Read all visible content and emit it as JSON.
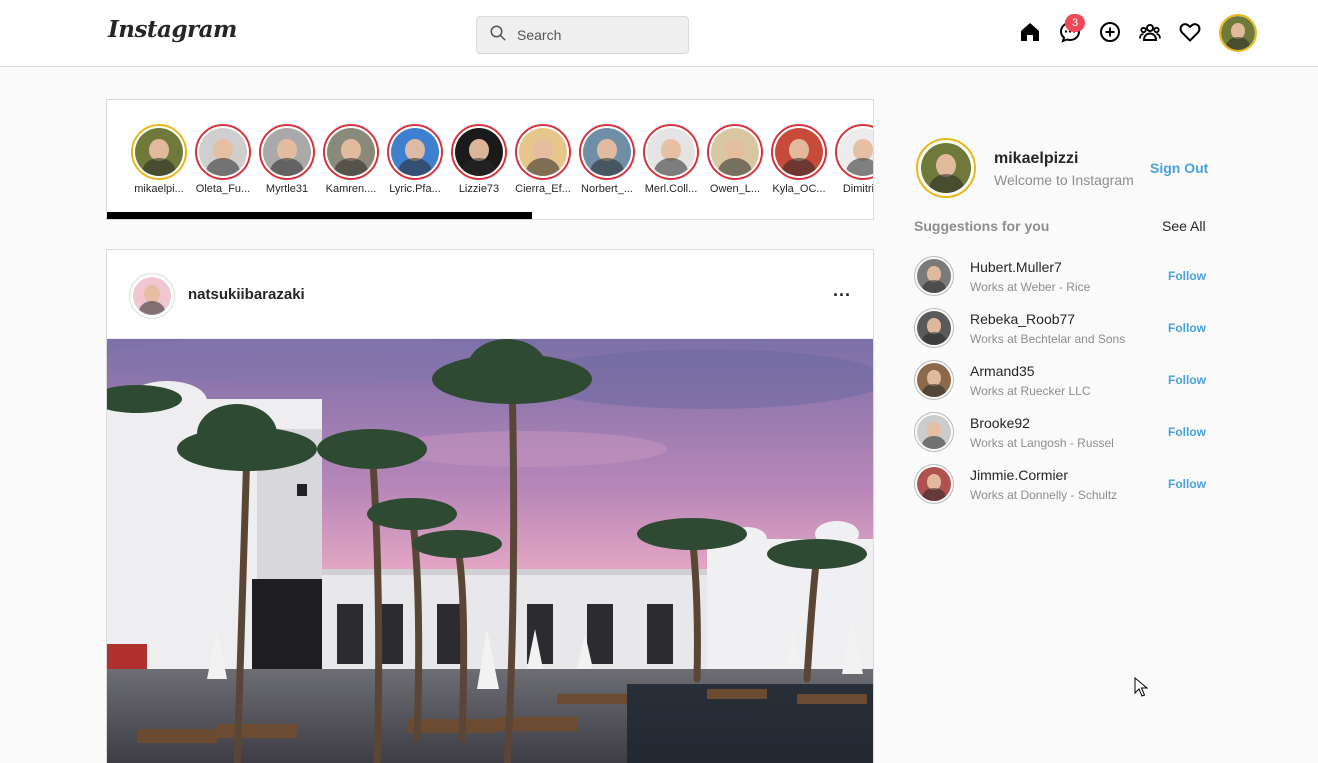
{
  "header": {
    "logo": "Instagram",
    "search_placeholder": "Search",
    "messages_badge": "3"
  },
  "stories": [
    {
      "name": "mikaelpi...",
      "own": true,
      "color": "#6f7a3a"
    },
    {
      "name": "Oleta_Fu...",
      "color": "#cfcfcf"
    },
    {
      "name": "Myrtle31",
      "color": "#a9a9a9"
    },
    {
      "name": "Kamren....",
      "color": "#8a8a7a"
    },
    {
      "name": "Lyric.Pfa...",
      "color": "#3f7fd0"
    },
    {
      "name": "Lizzie73",
      "color": "#1a1a1a"
    },
    {
      "name": "Cierra_Ef...",
      "color": "#e6c68a"
    },
    {
      "name": "Norbert_...",
      "color": "#6f8fa7"
    },
    {
      "name": "Merl.Coll...",
      "color": "#e4e4e4"
    },
    {
      "name": "Owen_L...",
      "color": "#d9c7a3"
    },
    {
      "name": "Kyla_OC...",
      "color": "#c74a3a"
    },
    {
      "name": "Dimitri...",
      "color": "#ececec"
    }
  ],
  "post": {
    "username": "natsukiibarazaki",
    "more": "..."
  },
  "sidebar": {
    "username": "mikaelpizzi",
    "welcome": "Welcome to Instagram",
    "sign_out": "Sign Out",
    "suggestions_title": "Suggestions for you",
    "see_all": "See All",
    "suggestions": [
      {
        "username": "Hubert.Muller7",
        "subtitle": "Works at Weber - Rice",
        "follow": "Follow",
        "color": "#7a7a7a"
      },
      {
        "username": "Rebeka_Roob77",
        "subtitle": "Works at Bechtelar and Sons",
        "follow": "Follow",
        "color": "#5a5a5a"
      },
      {
        "username": "Armand35",
        "subtitle": "Works at Ruecker LLC",
        "follow": "Follow",
        "color": "#8a6a4a"
      },
      {
        "username": "Brooke92",
        "subtitle": "Works at Langosh - Russel",
        "follow": "Follow",
        "color": "#cccccc"
      },
      {
        "username": "Jimmie.Cormier",
        "subtitle": "Works at Donnelly - Schultz",
        "follow": "Follow",
        "color": "#b05050"
      }
    ]
  },
  "colors": {
    "accent": "#48a3e0",
    "story_ring": "#d6323f",
    "own_ring": "#e8b719",
    "badge": "#ed4956"
  }
}
